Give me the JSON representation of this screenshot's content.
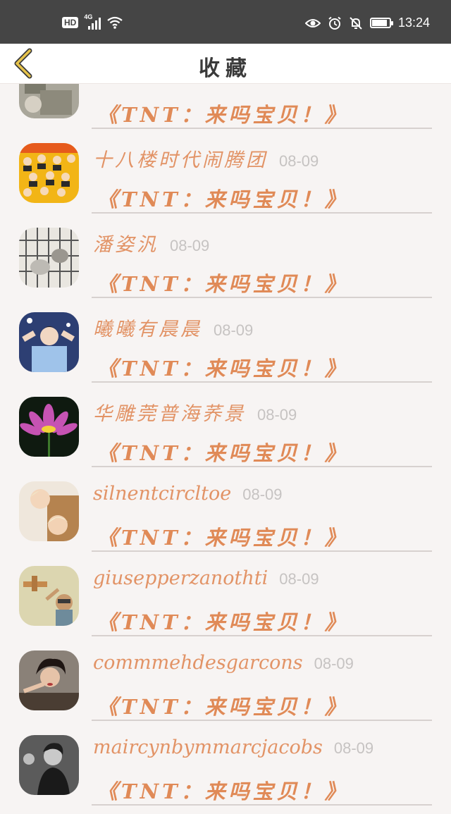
{
  "status_bar": {
    "hd": "HD",
    "network": "4G",
    "time": "13:24",
    "battery_percent": 80
  },
  "header": {
    "title": "收藏"
  },
  "items": [
    {
      "name": "",
      "date": "",
      "ref": "《TNT：来吗宝贝！》",
      "avatar": "collage-grey"
    },
    {
      "name": "十八楼时代闹腾团",
      "date": "08-09",
      "ref": "《TNT：来吗宝贝！》",
      "avatar": "group-yellow"
    },
    {
      "name": "潘姿汎",
      "date": "08-09",
      "ref": "《TNT：来吗宝贝！》",
      "avatar": "kitten-cage"
    },
    {
      "name": "曦曦有晨晨",
      "date": "08-09",
      "ref": "《TNT：来吗宝贝！》",
      "avatar": "boy-stage"
    },
    {
      "name": "华雕莞普海荞景",
      "date": "08-09",
      "ref": "《TNT：来吗宝贝！》",
      "avatar": "lotus"
    },
    {
      "name": "silnentcircltoe",
      "date": "08-09",
      "ref": "《TNT：来吗宝贝！》",
      "avatar": "couple"
    },
    {
      "name": "giusepperzanothti",
      "date": "08-09",
      "ref": "《TNT：来吗宝贝！》",
      "avatar": "aviator"
    },
    {
      "name": "commmehdesgarcons",
      "date": "08-09",
      "ref": "《TNT：来吗宝贝！》",
      "avatar": "woman-curly"
    },
    {
      "name": "maircynbymmarcjacobs",
      "date": "08-09",
      "ref": "《TNT：来吗宝贝！》",
      "avatar": "man-bw"
    }
  ],
  "colors": {
    "accent": "#e08a57",
    "status_bar": "#454545",
    "date": "#c6c3c2"
  }
}
